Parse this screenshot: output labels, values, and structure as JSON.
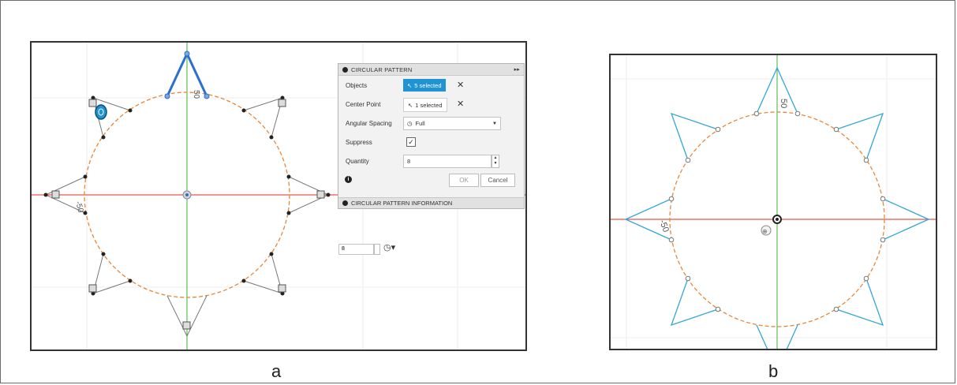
{
  "captions": {
    "a": "a",
    "b": "b"
  },
  "panel_a": {
    "dimension_top": "50",
    "dimension_left": "-50",
    "dialog": {
      "title": "CIRCULAR PATTERN",
      "rows": {
        "objects": {
          "label": "Objects",
          "value": "5 selected"
        },
        "center_point": {
          "label": "Center Point",
          "value": "1 selected"
        },
        "angular_spacing": {
          "label": "Angular Spacing",
          "value": "Full"
        },
        "suppress": {
          "label": "Suppress",
          "checked": true
        },
        "quantity": {
          "label": "Quantity",
          "value": "8"
        }
      },
      "ok_label": "OK",
      "cancel_label": "Cancel",
      "info_section": "CIRCULAR PATTERN INFORMATION"
    },
    "quantity_input_value": "8"
  },
  "panel_b": {
    "dimension_top": "50",
    "dimension_left": "-50"
  },
  "colors": {
    "accent_blue": "#1f93d3",
    "axis_red": "#e8574c",
    "axis_green": "#5cbd55",
    "circle_orange": "#e6873a",
    "sketch_blue": "#2b6fd1",
    "sketch_light_blue": "#34a6d8"
  }
}
